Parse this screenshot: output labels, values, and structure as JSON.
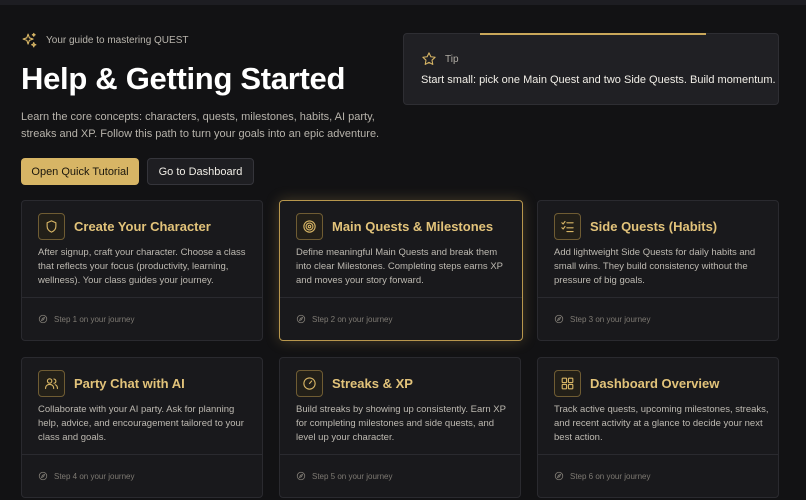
{
  "eyebrow": "Your guide to mastering QUEST",
  "title": "Help & Getting Started",
  "description": "Learn the core concepts: characters, quests, milestones, habits, AI party, streaks and XP. Follow this path to turn your goals into an epic adventure.",
  "buttons": {
    "primary": "Open Quick Tutorial",
    "secondary": "Go to Dashboard"
  },
  "tip": {
    "label": "Tip",
    "text": "Start small: pick one Main Quest and two Side Quests. Build momentum."
  },
  "accent": "#d7b565",
  "cards": [
    {
      "title": "Create Your Character",
      "icon": "shield-icon",
      "body": "After signup, craft your character. Choose a class that reflects your focus (productivity, learning, wellness). Your class guides your journey.",
      "step": "Step 1 on your journey"
    },
    {
      "title": "Main Quests & Milestones",
      "icon": "target-icon",
      "body": "Define meaningful Main Quests and break them into clear Milestones. Completing steps earns XP and moves your story forward.",
      "step": "Step 2 on your journey"
    },
    {
      "title": "Side Quests (Habits)",
      "icon": "checklist-icon",
      "body": "Add lightweight Side Quests for daily habits and small wins. They build consistency without the pressure of big goals.",
      "step": "Step 3 on your journey"
    },
    {
      "title": "Party Chat with AI",
      "icon": "users-icon",
      "body": "Collaborate with your AI party. Ask for planning help, advice, and encouragement tailored to your class and goals.",
      "step": "Step 4 on your journey"
    },
    {
      "title": "Streaks & XP",
      "icon": "gauge-icon",
      "body": "Build streaks by showing up consistently. Earn XP for completing milestones and side quests, and level up your character.",
      "step": "Step 5 on your journey"
    },
    {
      "title": "Dashboard Overview",
      "icon": "dashboard-icon",
      "body": "Track active quests, upcoming milestones, streaks, and recent activity at a glance to decide your next best action.",
      "step": "Step 6 on your journey"
    }
  ]
}
